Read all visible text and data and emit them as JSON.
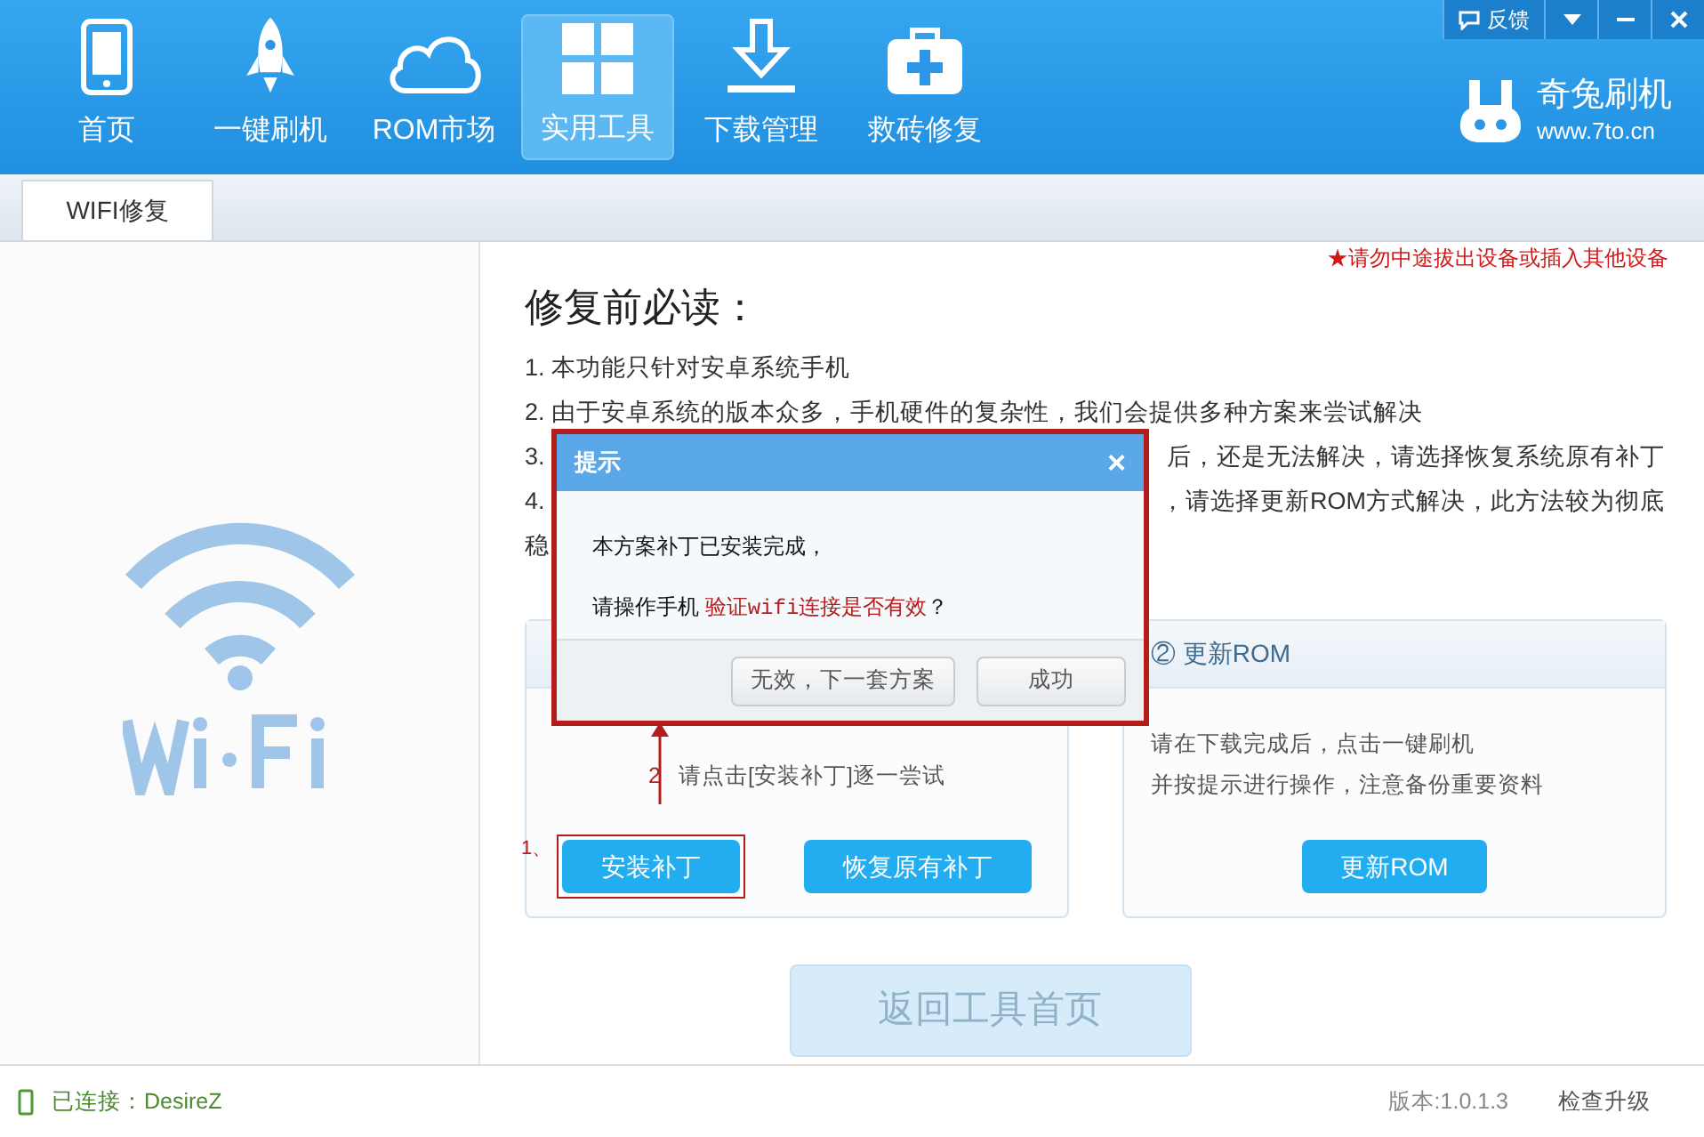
{
  "window_controls": {
    "feedback": "反馈"
  },
  "nav": [
    {
      "label": "首页",
      "selected": false
    },
    {
      "label": "一键刷机",
      "selected": false
    },
    {
      "label": "ROM市场",
      "selected": false
    },
    {
      "label": "实用工具",
      "selected": true
    },
    {
      "label": "下载管理",
      "selected": false
    },
    {
      "label": "救砖修复",
      "selected": false
    }
  ],
  "brand": {
    "name": "奇兔刷机",
    "url": "www.7to.cn"
  },
  "tabs": [
    {
      "label": "WIFI修复",
      "selected": true
    }
  ],
  "warning": "★请勿中途拔出设备或插入其他设备",
  "notice": {
    "title": "修复前必读：",
    "lines": [
      {
        "start": "1. 本功能只针对安卓系统手机"
      },
      {
        "start": "2. 由于安卓系统的版本众多，手机硬件的复杂性，我们会提供多种方案来尝试解决"
      },
      {
        "start": "3.",
        "end": "后，还是无法解决，请选择恢复系统原有补丁"
      },
      {
        "start": "4.",
        "end": "，请选择更新ROM方式解决，此方法较为彻底"
      },
      {
        "start": "稳"
      }
    ]
  },
  "cards": [
    {
      "lines": [
        "请点击[安装补丁]逐一尝试"
      ],
      "buttons": [
        {
          "label": "安装补丁",
          "highlighted": true
        },
        {
          "label": "恢复原有补丁",
          "highlighted": false
        }
      ]
    },
    {
      "title": "② 更新ROM",
      "lines": [
        "请在下载完成后，点击一键刷机",
        "并按提示进行操作，注意备份重要资料"
      ],
      "buttons": [
        {
          "label": "更新ROM",
          "highlighted": false
        }
      ]
    }
  ],
  "annotations": {
    "step_1": "1、",
    "step_2": "2"
  },
  "back_button": "返回工具首页",
  "dialog": {
    "title": "提示",
    "close": "×",
    "line_1": "本方案补丁已安装完成，",
    "line_2": "请操作手机 **验证wifi连接是否有效**？",
    "buttons": [
      "无效，下一套方案",
      "成功"
    ]
  },
  "status_bar": {
    "connection": "已连接：DesireZ",
    "version": "版本:1.0.1.3",
    "update": "检查升级"
  }
}
